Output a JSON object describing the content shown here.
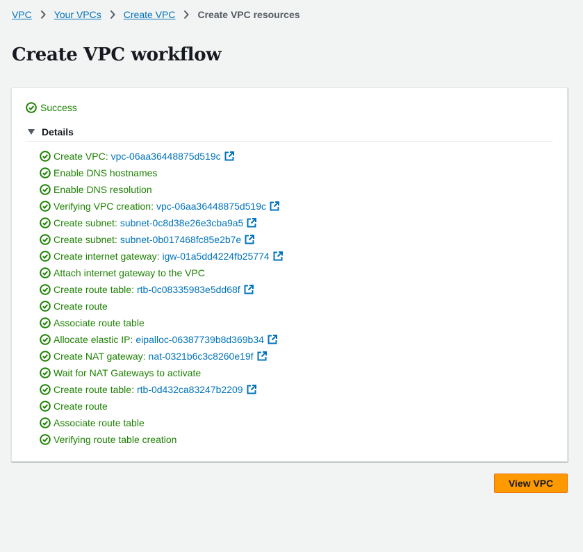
{
  "breadcrumb": {
    "items": [
      "VPC",
      "Your VPCs",
      "Create VPC"
    ],
    "current": "Create VPC resources"
  },
  "page": {
    "title": "Create VPC workflow"
  },
  "status": {
    "label": "Success",
    "color": "#1d8102",
    "icon": "check-circle-icon"
  },
  "details": {
    "label": "Details",
    "icon": "caret-down-icon",
    "steps": [
      {
        "text": "Create VPC:",
        "link": "vpc-06aa36448875d519c"
      },
      {
        "text": "Enable DNS hostnames"
      },
      {
        "text": "Enable DNS resolution"
      },
      {
        "text": "Verifying VPC creation:",
        "link": "vpc-06aa36448875d519c"
      },
      {
        "text": "Create subnet:",
        "link": "subnet-0c8d38e26e3cba9a5"
      },
      {
        "text": "Create subnet:",
        "link": "subnet-0b017468fc85e2b7e"
      },
      {
        "text": "Create internet gateway:",
        "link": "igw-01a5dd4224fb25774"
      },
      {
        "text": "Attach internet gateway to the VPC"
      },
      {
        "text": "Create route table:",
        "link": "rtb-0c08335983e5dd68f"
      },
      {
        "text": "Create route"
      },
      {
        "text": "Associate route table"
      },
      {
        "text": "Allocate elastic IP:",
        "link": "eipalloc-06387739b8d369b34"
      },
      {
        "text": "Create NAT gateway:",
        "link": "nat-0321b6c3c8260e19f"
      },
      {
        "text": "Wait for NAT Gateways to activate"
      },
      {
        "text": "Create route table:",
        "link": "rtb-0d432ca83247b2209"
      },
      {
        "text": "Create route"
      },
      {
        "text": "Associate route table"
      },
      {
        "text": "Verifying route table creation"
      }
    ]
  },
  "actions": {
    "view_vpc_label": "View VPC",
    "accent": "#ff9900"
  },
  "colors": {
    "link": "#0073bb",
    "success": "#1d8102",
    "background": "#f2f3f3"
  }
}
